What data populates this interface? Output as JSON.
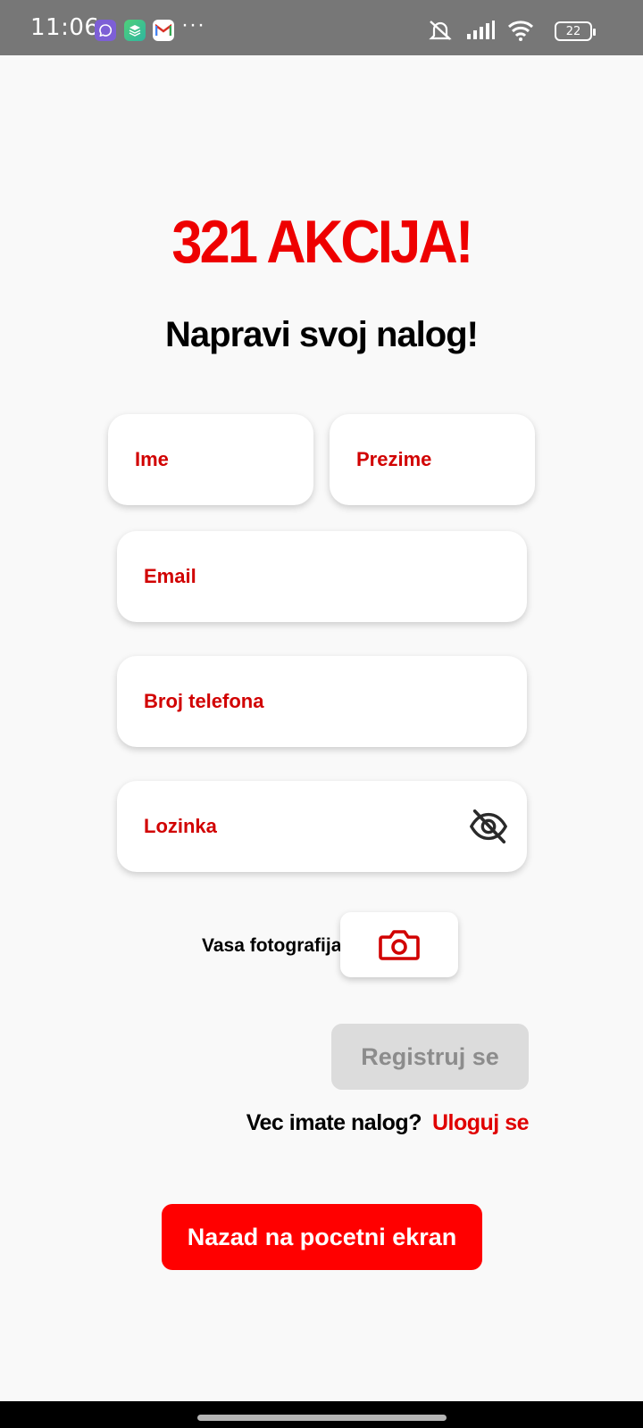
{
  "status_bar": {
    "time": "11:06",
    "more": "···",
    "battery": "22",
    "icons": [
      "viber-icon",
      "layers-app-icon",
      "gmail-icon",
      "mute-icon",
      "signal-icon",
      "wifi-icon",
      "battery-icon"
    ]
  },
  "header": {
    "brand": "321 AKCIJA!",
    "subtitle": "Napravi svoj nalog!"
  },
  "form": {
    "first_name_placeholder": "Ime",
    "last_name_placeholder": "Prezime",
    "email_placeholder": "Email",
    "phone_placeholder": "Broj telefona",
    "password_placeholder": "Lozinka",
    "password_toggle_icon": "eye-off-icon",
    "photo_label": "Vasa fotografija",
    "photo_icon": "camera-icon"
  },
  "actions": {
    "register_label": "Registruj se",
    "login_question": "Vec imate nalog?",
    "login_link": "Uloguj se",
    "back_label": "Nazad na pocetni ekran"
  },
  "colors": {
    "accent": "#ff0000",
    "placeholder": "#d10000",
    "disabled_button": "#dcdcdc",
    "status_bar": "#777777"
  }
}
